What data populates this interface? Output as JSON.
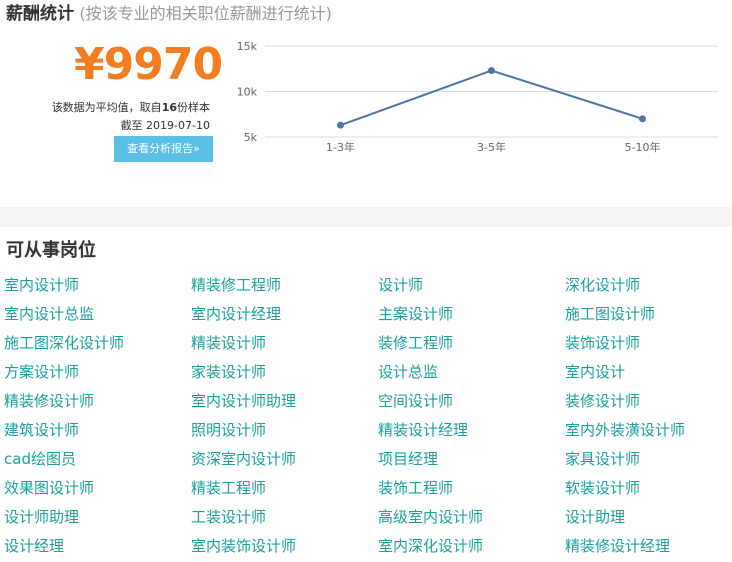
{
  "salary": {
    "title": "薪酬统计",
    "subtitle": "(按该专业的相关职位薪酬进行统计)",
    "average": "¥9970",
    "note_prefix": "该数据为平均值，取自",
    "sample_count": "16",
    "note_suffix": "份样本",
    "date_text": "截至 2019-07-10",
    "report_button": "查看分析报告»"
  },
  "chart_data": {
    "type": "line",
    "categories": [
      "1-3年",
      "3-5年",
      "5-10年"
    ],
    "values": [
      6300,
      12300,
      7000
    ],
    "ylim": [
      5000,
      15000
    ],
    "y_ticks": [
      5000,
      10000,
      15000
    ],
    "y_tick_labels": [
      "5k",
      "10k",
      "15k"
    ],
    "grid": "horizontal",
    "line_color": "#4e73a6",
    "grid_color": "#dddddd"
  },
  "jobs": {
    "title": "可从事岗位",
    "items": [
      "室内设计师",
      "精装修工程师",
      "设计师",
      "深化设计师",
      "室内设计总监",
      "室内设计经理",
      "主案设计师",
      "施工图设计师",
      "施工图深化设计师",
      "精装设计师",
      "装修工程师",
      "装饰设计师",
      "方案设计师",
      "家装设计师",
      "设计总监",
      "室内设计",
      "精装修设计师",
      "室内设计师助理",
      "空间设计师",
      "装修设计师",
      "建筑设计师",
      "照明设计师",
      "精装设计经理",
      "室内外装潢设计师",
      "cad绘图员",
      "资深室内设计师",
      "项目经理",
      "家具设计师",
      "效果图设计师",
      "精装工程师",
      "装饰工程师",
      "软装设计师",
      "设计师助理",
      "工装设计师",
      "高级室内设计师",
      "设计助理",
      "设计经理",
      "室内装饰设计师",
      "室内深化设计师",
      "精装修设计经理"
    ]
  }
}
